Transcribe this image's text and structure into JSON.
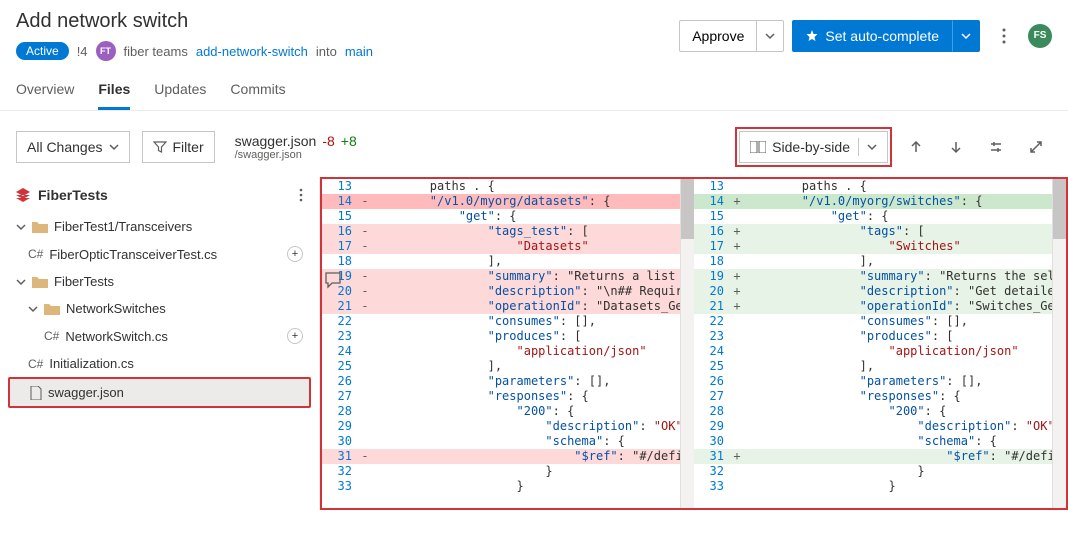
{
  "title": "Add network switch",
  "meta": {
    "status": "Active",
    "pr_id": "!4",
    "team_initials": "FT",
    "team_name": "fiber teams",
    "branch": "add-network-switch",
    "into": "into",
    "target": "main"
  },
  "actions": {
    "approve": "Approve",
    "set_auto": "Set auto-complete",
    "user_initials": "FS"
  },
  "tabs": [
    "Overview",
    "Files",
    "Updates",
    "Commits"
  ],
  "active_tab": "Files",
  "toolbar": {
    "changes": "All Changes",
    "filter": "Filter",
    "file_name": "swagger.json",
    "file_path": "/swagger.json",
    "deletions": "-8",
    "additions": "+8",
    "view_mode": "Side-by-side"
  },
  "repo": {
    "name": "FiberTests",
    "tree": [
      {
        "type": "folder",
        "name": "FiberTest1/Transceivers",
        "indent": 0,
        "expanded": true
      },
      {
        "type": "file",
        "name": "FiberOpticTransceiverTest.cs",
        "prefix": "C#",
        "indent": 1,
        "badge": "+"
      },
      {
        "type": "folder",
        "name": "FiberTests",
        "indent": 0,
        "expanded": true
      },
      {
        "type": "folder",
        "name": "NetworkSwitches",
        "indent": 1,
        "expanded": true
      },
      {
        "type": "file",
        "name": "NetworkSwitch.cs",
        "prefix": "C#",
        "indent": 2,
        "badge": "+"
      },
      {
        "type": "file",
        "name": "Initialization.cs",
        "prefix": "C#",
        "indent": 1
      },
      {
        "type": "file",
        "name": "swagger.json",
        "indent": 1,
        "selected": true,
        "icon": "doc"
      }
    ]
  },
  "diff": {
    "left": [
      {
        "n": 13,
        "m": "",
        "cls": "",
        "text": "        paths . {"
      },
      {
        "n": 14,
        "m": "-",
        "cls": "removed-dark",
        "text": "        \"/v1.0/myorg/datasets\": {"
      },
      {
        "n": 15,
        "m": "",
        "cls": "",
        "text": "            \"get\": {"
      },
      {
        "n": 16,
        "m": "-",
        "cls": "removed",
        "text": "                \"tags_test\": ["
      },
      {
        "n": 17,
        "m": "-",
        "cls": "removed",
        "text": "                    \"Datasets\""
      },
      {
        "n": 18,
        "m": "",
        "cls": "",
        "text": "                ],"
      },
      {
        "n": 19,
        "m": "-",
        "cls": "removed",
        "text": "                \"summary\": \"Returns a list of"
      },
      {
        "n": 20,
        "m": "-",
        "cls": "removed",
        "text": "                \"description\": \"\\n## Required"
      },
      {
        "n": 21,
        "m": "-",
        "cls": "removed",
        "text": "                \"operationId\": \"Datasets_GetD"
      },
      {
        "n": 22,
        "m": "",
        "cls": "",
        "text": "                \"consumes\": [],"
      },
      {
        "n": 23,
        "m": "",
        "cls": "",
        "text": "                \"produces\": ["
      },
      {
        "n": 24,
        "m": "",
        "cls": "",
        "text": "                    \"application/json\""
      },
      {
        "n": 25,
        "m": "",
        "cls": "",
        "text": "                ],"
      },
      {
        "n": 26,
        "m": "",
        "cls": "",
        "text": "                \"parameters\": [],"
      },
      {
        "n": 27,
        "m": "",
        "cls": "",
        "text": "                \"responses\": {"
      },
      {
        "n": 28,
        "m": "",
        "cls": "",
        "text": "                    \"200\": {"
      },
      {
        "n": 29,
        "m": "",
        "cls": "",
        "text": "                        \"description\": \"OK\","
      },
      {
        "n": 30,
        "m": "",
        "cls": "",
        "text": "                        \"schema\": {"
      },
      {
        "n": 31,
        "m": "-",
        "cls": "removed",
        "text": "                            \"$ref\": \"#/definit"
      },
      {
        "n": 32,
        "m": "",
        "cls": "",
        "text": "                        }"
      },
      {
        "n": 33,
        "m": "",
        "cls": "",
        "text": "                    }"
      }
    ],
    "right": [
      {
        "n": 13,
        "m": "",
        "cls": "",
        "text": "        paths . {"
      },
      {
        "n": 14,
        "m": "+",
        "cls": "added-dark",
        "text": "        \"/v1.0/myorg/switches\": {"
      },
      {
        "n": 15,
        "m": "",
        "cls": "",
        "text": "            \"get\": {"
      },
      {
        "n": 16,
        "m": "+",
        "cls": "added",
        "text": "                \"tags\": ["
      },
      {
        "n": 17,
        "m": "+",
        "cls": "added",
        "text": "                    \"Switches\""
      },
      {
        "n": 18,
        "m": "",
        "cls": "",
        "text": "                ],"
      },
      {
        "n": 19,
        "m": "+",
        "cls": "added",
        "text": "                \"summary\": \"Returns the select"
      },
      {
        "n": 20,
        "m": "+",
        "cls": "added",
        "text": "                \"description\": \"Get detailed s"
      },
      {
        "n": 21,
        "m": "+",
        "cls": "added",
        "text": "                \"operationId\": \"Switches_GetSw"
      },
      {
        "n": 22,
        "m": "",
        "cls": "",
        "text": "                \"consumes\": [],"
      },
      {
        "n": 23,
        "m": "",
        "cls": "",
        "text": "                \"produces\": ["
      },
      {
        "n": 24,
        "m": "",
        "cls": "",
        "text": "                    \"application/json\""
      },
      {
        "n": 25,
        "m": "",
        "cls": "",
        "text": "                ],"
      },
      {
        "n": 26,
        "m": "",
        "cls": "",
        "text": "                \"parameters\": [],"
      },
      {
        "n": 27,
        "m": "",
        "cls": "",
        "text": "                \"responses\": {"
      },
      {
        "n": 28,
        "m": "",
        "cls": "",
        "text": "                    \"200\": {"
      },
      {
        "n": 29,
        "m": "",
        "cls": "",
        "text": "                        \"description\": \"OK\","
      },
      {
        "n": 30,
        "m": "",
        "cls": "",
        "text": "                        \"schema\": {"
      },
      {
        "n": 31,
        "m": "+",
        "cls": "added",
        "text": "                            \"$ref\": \"#/definit"
      },
      {
        "n": 32,
        "m": "",
        "cls": "",
        "text": "                        }"
      },
      {
        "n": 33,
        "m": "",
        "cls": "",
        "text": "                    }"
      }
    ]
  }
}
